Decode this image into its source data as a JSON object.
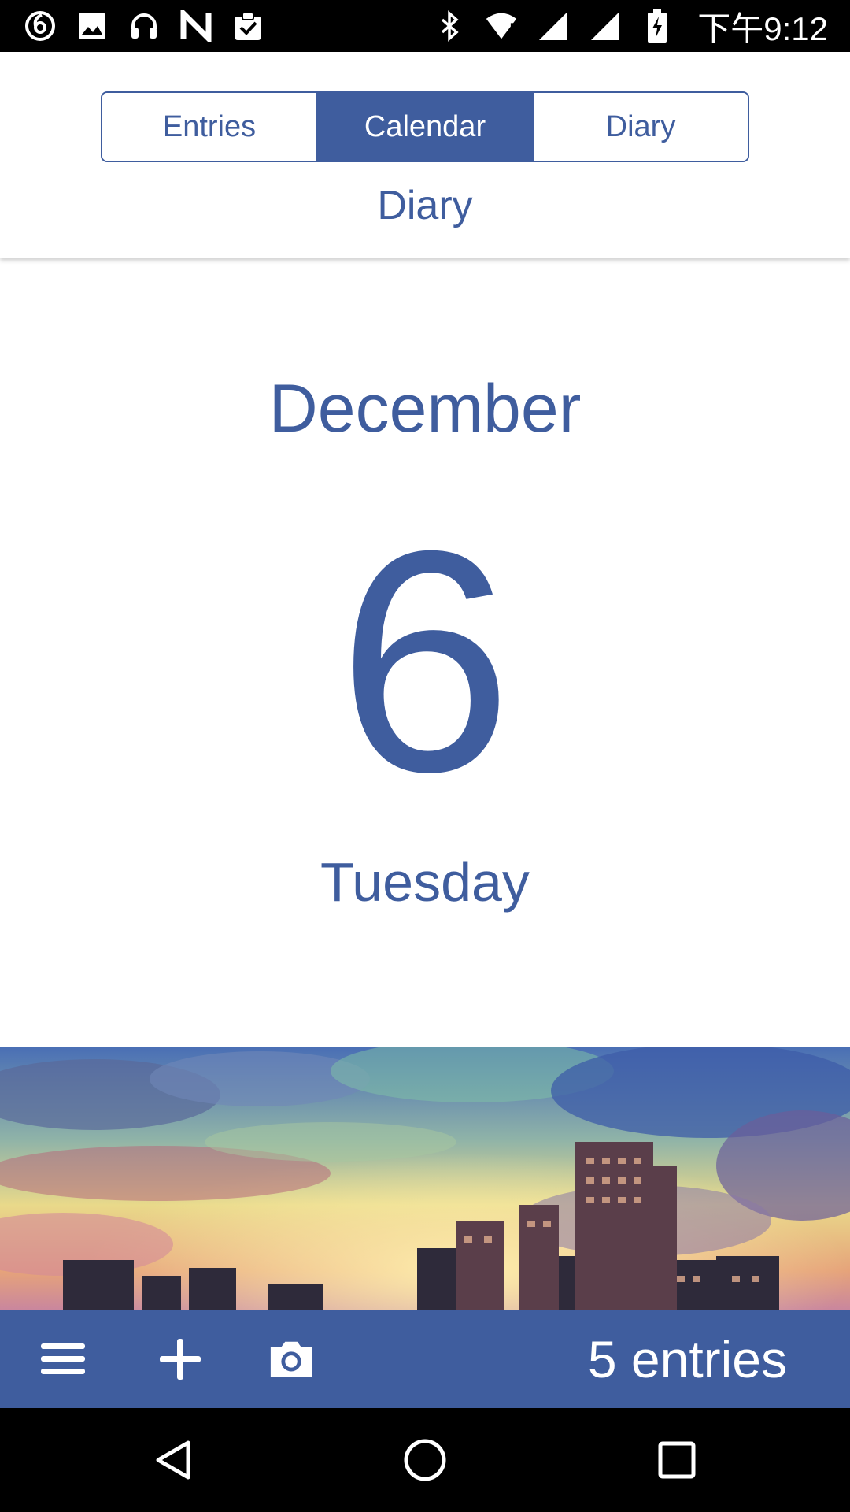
{
  "status_bar": {
    "time": "下午9:12",
    "left_icons": [
      "netease-music-icon",
      "image-icon",
      "headset-icon",
      "n-app-icon",
      "clipboard-check-icon"
    ],
    "right_icons": [
      "bluetooth-icon",
      "wifi-alert-icon",
      "signal-icon",
      "signal-icon",
      "battery-charging-icon"
    ]
  },
  "tabs": [
    {
      "label": "Entries",
      "active": false
    },
    {
      "label": "Calendar",
      "active": true
    },
    {
      "label": "Diary",
      "active": false
    }
  ],
  "header": {
    "title": "Diary"
  },
  "date": {
    "month": "December",
    "day": "6",
    "weekday": "Tuesday"
  },
  "toolbar": {
    "buttons": [
      "menu-icon",
      "add-icon",
      "camera-icon"
    ],
    "entries_count": "5 entries"
  },
  "nav_bar": {
    "buttons": [
      "back-icon",
      "home-icon",
      "recents-icon"
    ]
  },
  "colors": {
    "accent": "#3f5d9e",
    "status_bar": "#000000",
    "background": "#ffffff"
  }
}
